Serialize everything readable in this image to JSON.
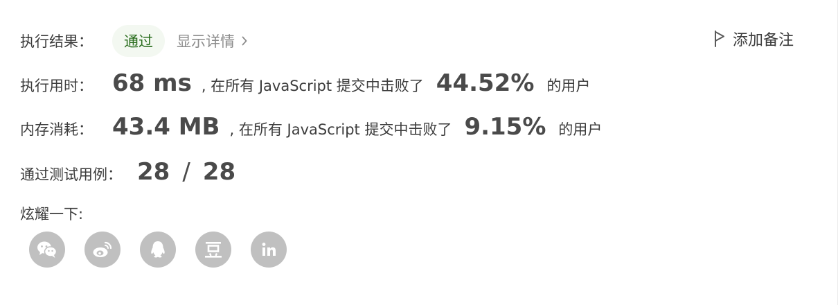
{
  "result": {
    "label": "执行结果：",
    "status": "通过",
    "details_link": "显示详情"
  },
  "add_note": "添加备注",
  "runtime": {
    "label": "执行用时：",
    "value": "68 ms",
    "prefix": ", 在所有 JavaScript 提交中击败了",
    "percent": "44.52%",
    "suffix": "的用户"
  },
  "memory": {
    "label": "内存消耗：",
    "value": "43.4 MB",
    "prefix": ", 在所有 JavaScript 提交中击败了",
    "percent": "9.15%",
    "suffix": "的用户"
  },
  "tests": {
    "label": "通过测试用例：",
    "passed": "28",
    "separator": "/",
    "total": "28"
  },
  "share": {
    "label": "炫耀一下:",
    "icons": [
      "wechat-icon",
      "weibo-icon",
      "qq-icon",
      "douban-icon",
      "linkedin-icon"
    ]
  },
  "colors": {
    "badge_bg": "#f3f8f1",
    "badge_text": "#2b6e1f",
    "icon_bg": "#c0c0c0"
  }
}
